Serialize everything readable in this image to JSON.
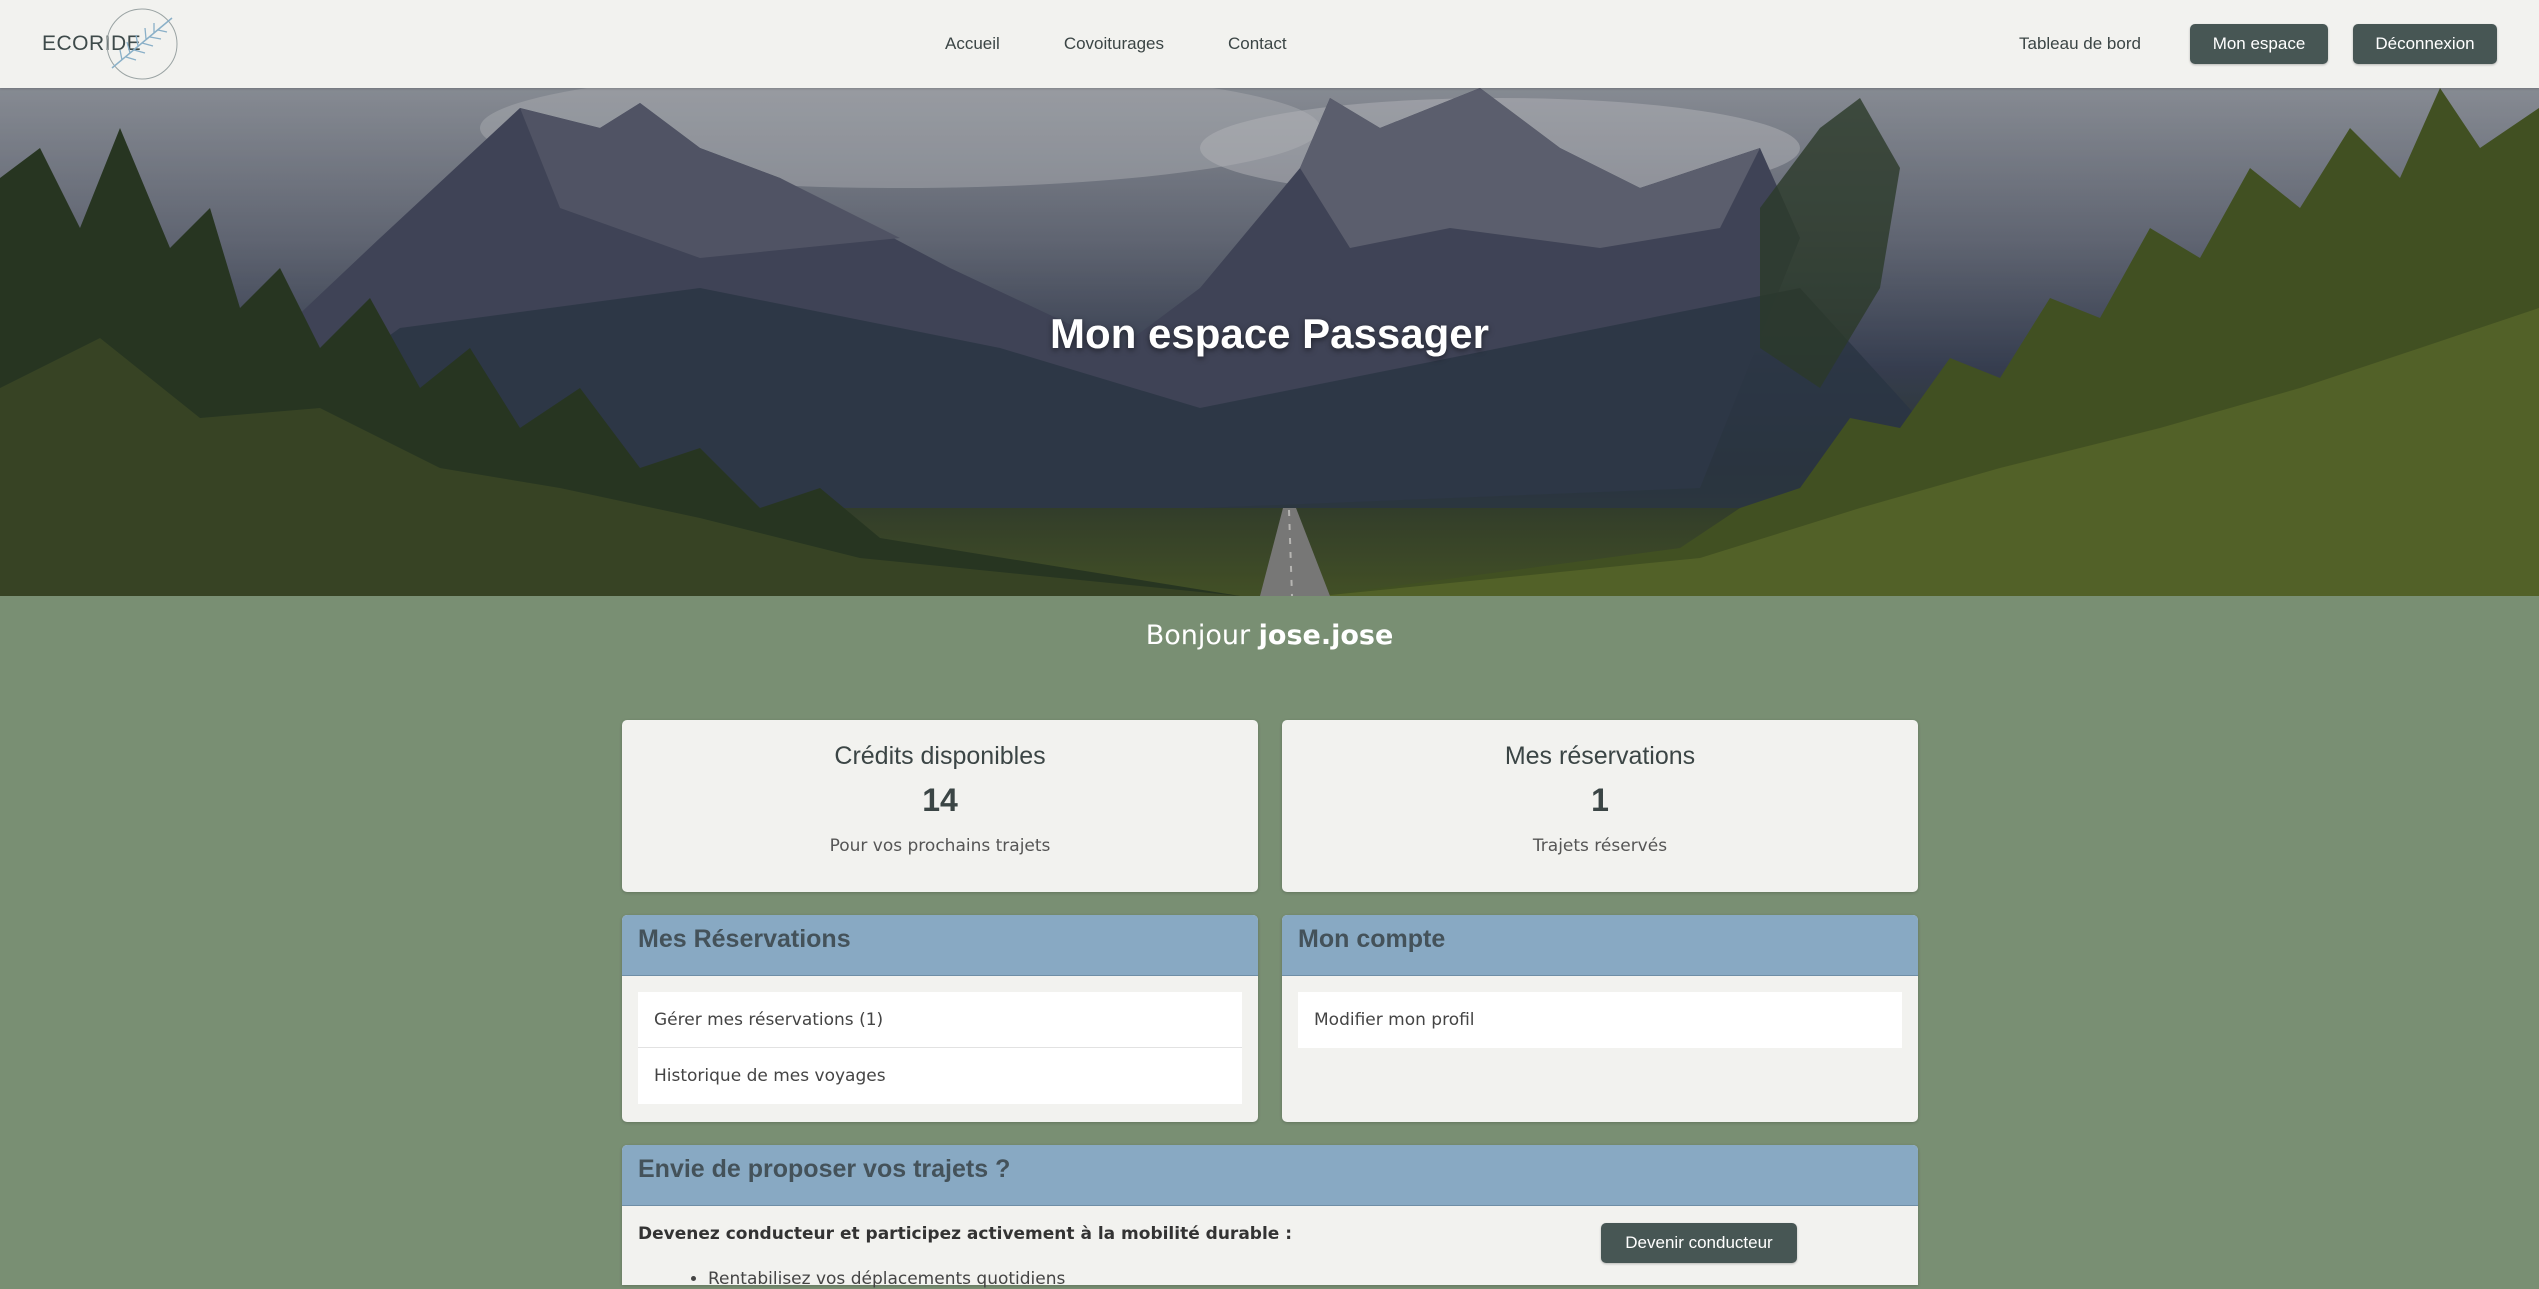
{
  "brand": {
    "name": "ECORIDE"
  },
  "nav": {
    "links": [
      "Accueil",
      "Covoiturages",
      "Contact"
    ],
    "dashboard": "Tableau de bord",
    "my_space": "Mon espace",
    "logout": "Déconnexion"
  },
  "hero": {
    "title": "Mon espace Passager"
  },
  "greeting": {
    "prefix": "Bonjour",
    "username": "jose.jose"
  },
  "stats": [
    {
      "title": "Crédits disponibles",
      "value": "14",
      "subtitle": "Pour vos prochains trajets"
    },
    {
      "title": "Mes réservations",
      "value": "1",
      "subtitle": "Trajets réservés"
    }
  ],
  "reservations_panel": {
    "title": "Mes Réservations",
    "items": [
      "Gérer mes réservations (1)",
      "Historique de mes voyages"
    ]
  },
  "account_panel": {
    "title": "Mon compte",
    "items": [
      "Modifier mon profil"
    ]
  },
  "driver_panel": {
    "title": "Envie de proposer vos trajets ?",
    "intro": "Devenez conducteur et participez activement à la mobilité durable :",
    "bullets": [
      "Rentabilisez vos déplacements quotidiens"
    ],
    "button": "Devenir conducteur"
  },
  "colors": {
    "page_bg": "#798f73",
    "header_bg": "#f2f2ef",
    "button_dark": "#475654",
    "panel_head": "#88a9c3",
    "card_bg": "#f2f2ef"
  }
}
